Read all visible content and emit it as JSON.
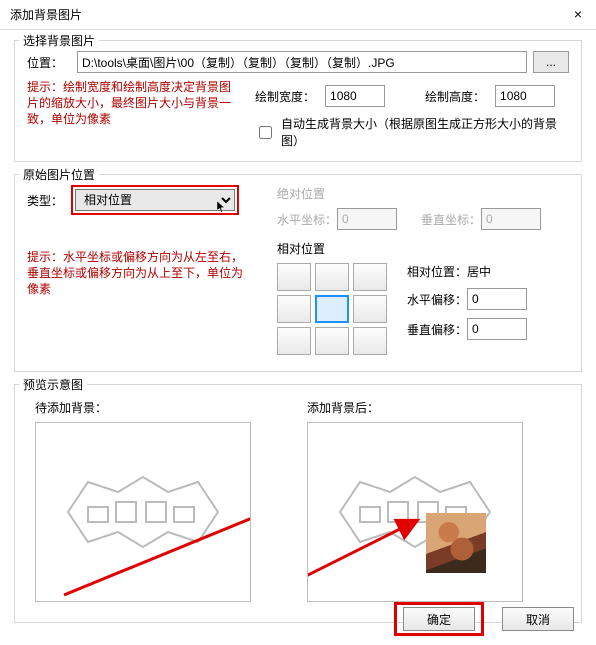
{
  "window": {
    "title": "添加背景图片",
    "close_icon": "×"
  },
  "section_select": {
    "legend": "选择背景图片",
    "path_label": "位置：",
    "path_value": "D:\\tools\\桌面\\图片\\00（复制）（复制）（复制）（复制）.JPG",
    "browse_label": "...",
    "hint": "提示：绘制宽度和绘制高度决定背景图片的缩放大小，最终图片大小与背景一致，单位为像素",
    "draw_width_label": "绘制宽度：",
    "draw_width_value": "1080",
    "draw_height_label": "绘制高度：",
    "draw_height_value": "1080",
    "checkbox_label": "自动生成背景大小（根据原图生成正方形大小的背景图）",
    "checkbox_checked": false
  },
  "section_origpos": {
    "legend": "原始图片位置",
    "type_label": "类型：",
    "type_value": "相对位置",
    "hint": "提示：水平坐标或偏移方向为从左至右，垂直坐标或偏移方向为从上至下，单位为像素",
    "abs_group": "绝对位置",
    "abs_x_label": "水平坐标：",
    "abs_x_value": "0",
    "abs_y_label": "垂直坐标：",
    "abs_y_value": "0",
    "rel_group": "相对位置",
    "rel_pos_label": "相对位置：",
    "rel_pos_value": "居中",
    "rel_hoff_label": "水平偏移：",
    "rel_hoff_value": "0",
    "rel_voff_label": "垂直偏移：",
    "rel_voff_value": "0"
  },
  "section_preview": {
    "legend": "预览示意图",
    "before_label": "待添加背景：",
    "after_label": "添加背景后："
  },
  "footer": {
    "ok": "确定",
    "cancel": "取消"
  }
}
